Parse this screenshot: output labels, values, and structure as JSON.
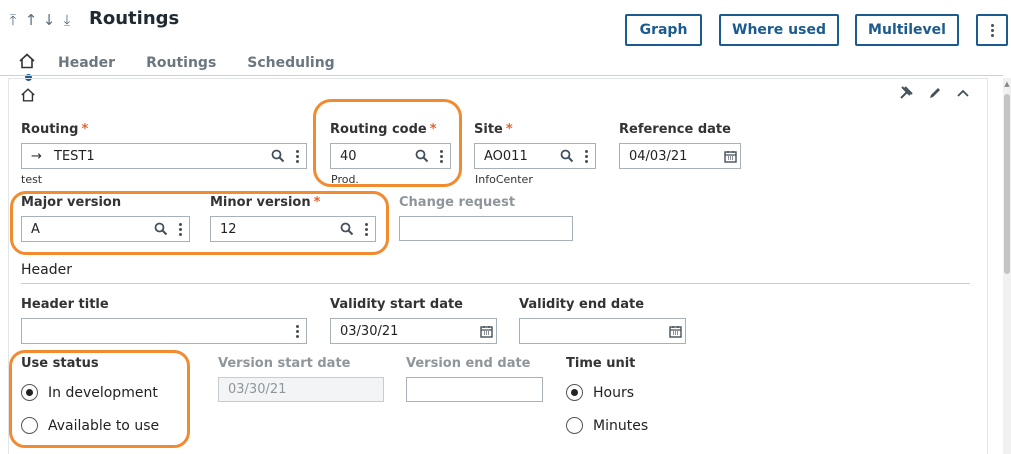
{
  "page": {
    "title": "Routings"
  },
  "actions": {
    "graph": "Graph",
    "where_used": "Where used",
    "multilevel": "Multilevel"
  },
  "tabs": [
    {
      "label": "Header"
    },
    {
      "label": "Routings"
    },
    {
      "label": "Scheduling"
    }
  ],
  "fields": {
    "routing": {
      "label": "Routing",
      "value": "TEST1",
      "desc": "test"
    },
    "routing_code": {
      "label": "Routing code",
      "value": "40",
      "desc": "Prod."
    },
    "site": {
      "label": "Site",
      "value": "AO011",
      "desc": "InfoCenter"
    },
    "reference_date": {
      "label": "Reference date",
      "value": "04/03/21"
    },
    "major_version": {
      "label": "Major version",
      "value": "A"
    },
    "minor_version": {
      "label": "Minor version",
      "value": "12"
    },
    "change_request": {
      "label": "Change request",
      "value": ""
    },
    "header_title": {
      "label": "Header title",
      "value": ""
    },
    "validity_start": {
      "label": "Validity start date",
      "value": "03/30/21"
    },
    "validity_end": {
      "label": "Validity end date",
      "value": ""
    },
    "version_start": {
      "label": "Version start date",
      "value": "03/30/21"
    },
    "version_end": {
      "label": "Version end date",
      "value": ""
    }
  },
  "section": {
    "header": "Header"
  },
  "use_status": {
    "label": "Use status",
    "options": [
      {
        "label": "In development",
        "selected": true
      },
      {
        "label": "Available to use",
        "selected": false
      }
    ]
  },
  "time_unit": {
    "label": "Time unit",
    "options": [
      {
        "label": "Hours",
        "selected": true
      },
      {
        "label": "Minutes",
        "selected": false
      }
    ]
  },
  "colors": {
    "accent": "#1b5b8f",
    "required": "#e4622f",
    "highlight": "#f28a30"
  }
}
